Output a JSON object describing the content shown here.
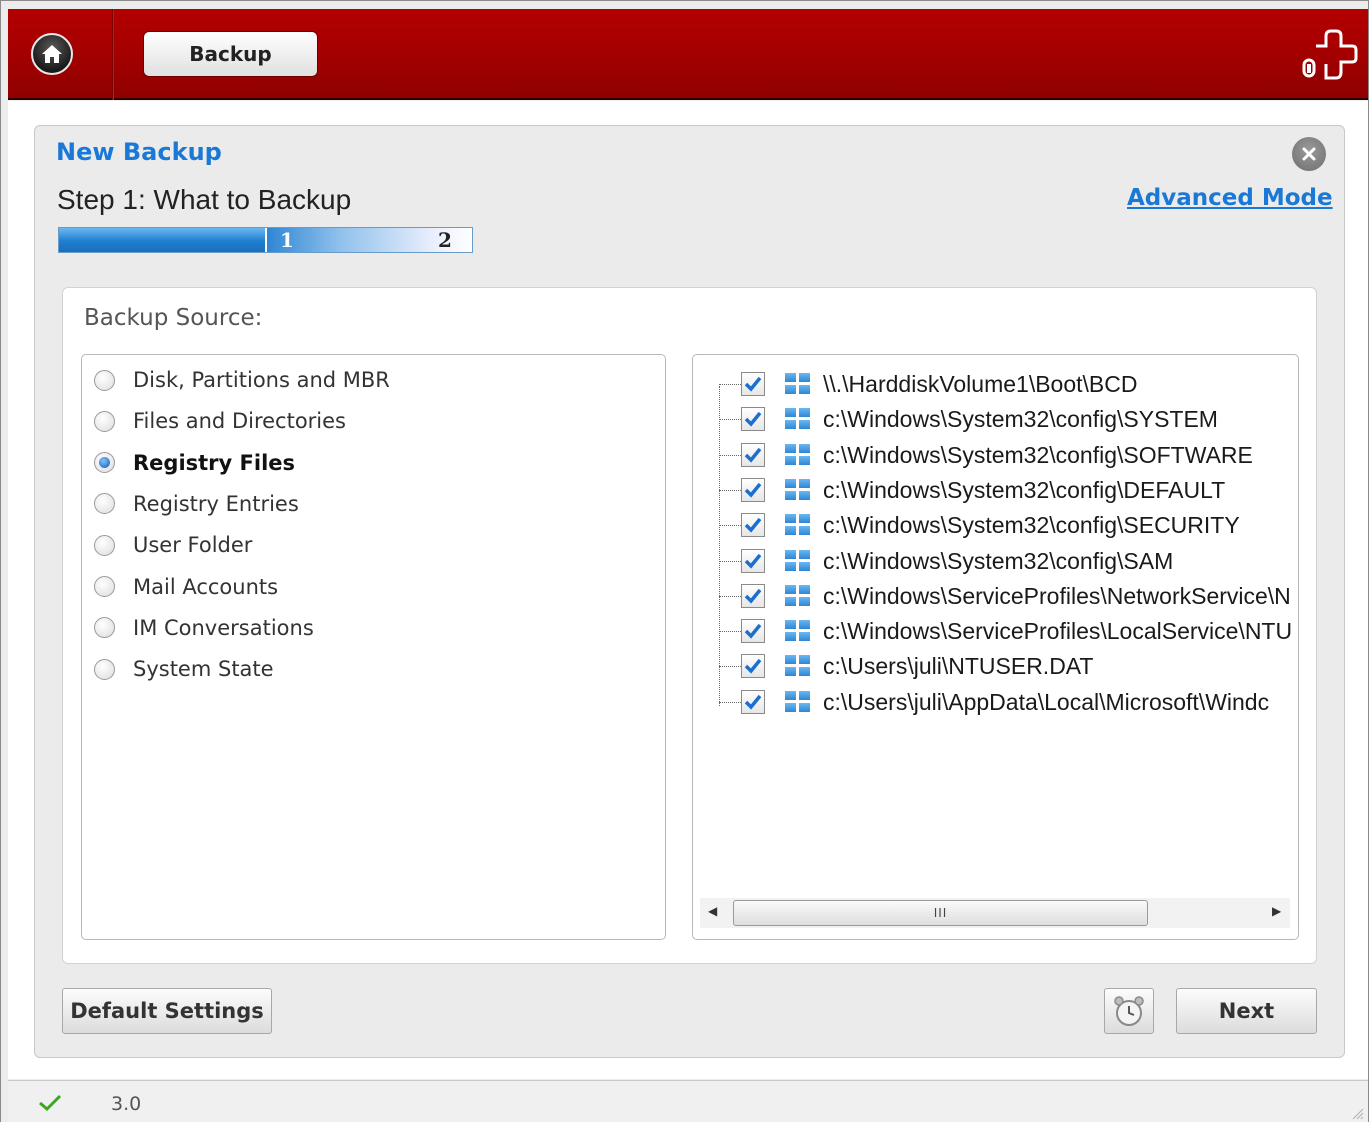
{
  "topbar": {
    "tab_label": "Backup",
    "accent_color": "#a60000",
    "icons": [
      "home-icon",
      "plugin-icon"
    ]
  },
  "dialog": {
    "title": "New Backup",
    "step_title": "Step 1: What to Backup",
    "advanced_link": "Advanced Mode",
    "progress": {
      "current_step": 1,
      "total_steps": 2,
      "step1": "1",
      "step2": "2"
    },
    "source_label": "Backup Source:",
    "sources": [
      {
        "label": "Disk, Partitions and MBR",
        "selected": false
      },
      {
        "label": "Files and Directories",
        "selected": false
      },
      {
        "label": "Registry Files",
        "selected": true
      },
      {
        "label": "Registry Entries",
        "selected": false
      },
      {
        "label": "User Folder",
        "selected": false
      },
      {
        "label": "Mail Accounts",
        "selected": false
      },
      {
        "label": "IM Conversations",
        "selected": false
      },
      {
        "label": "System State",
        "selected": false
      }
    ],
    "files": [
      {
        "path": "\\\\.\\HarddiskVolume1\\Boot\\BCD",
        "checked": true
      },
      {
        "path": "c:\\Windows\\System32\\config\\SYSTEM",
        "checked": true
      },
      {
        "path": "c:\\Windows\\System32\\config\\SOFTWARE",
        "checked": true
      },
      {
        "path": "c:\\Windows\\System32\\config\\DEFAULT",
        "checked": true
      },
      {
        "path": "c:\\Windows\\System32\\config\\SECURITY",
        "checked": true
      },
      {
        "path": "c:\\Windows\\System32\\config\\SAM",
        "checked": true
      },
      {
        "path": "c:\\Windows\\ServiceProfiles\\NetworkService\\N",
        "checked": true
      },
      {
        "path": "c:\\Windows\\ServiceProfiles\\LocalService\\NTU",
        "checked": true
      },
      {
        "path": "c:\\Users\\juli\\NTUSER.DAT",
        "checked": true
      },
      {
        "path": "c:\\Users\\juli\\AppData\\Local\\Microsoft\\Windc",
        "checked": true
      }
    ],
    "scrollbar_thumb": "III",
    "default_settings_label": "Default Settings",
    "next_label": "Next"
  },
  "status": {
    "version": "3.0",
    "ok_icon": "check-icon"
  }
}
